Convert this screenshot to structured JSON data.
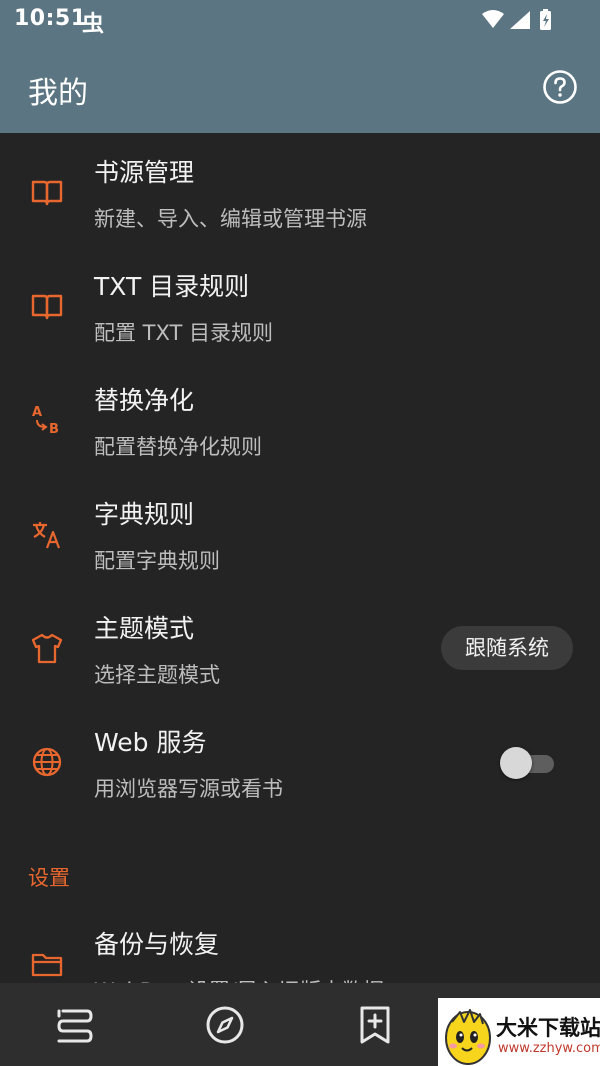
{
  "status_bar": {
    "time": "10:51",
    "notification_icon": "bug-icon",
    "icons": [
      "wifi-icon",
      "signal-icon",
      "battery-charging-icon"
    ]
  },
  "app_bar": {
    "title": "我的",
    "help_icon": "help-circle-icon"
  },
  "items": [
    {
      "icon": "book-open-icon",
      "title": "书源管理",
      "subtitle": "新建、导入、编辑或管理书源"
    },
    {
      "icon": "book-open-icon",
      "title": "TXT 目录规则",
      "subtitle": "配置 TXT 目录规则"
    },
    {
      "icon": "replace-ab-icon",
      "title": "替换净化",
      "subtitle": "配置替换净化规则"
    },
    {
      "icon": "translate-icon",
      "title": "字典规则",
      "subtitle": "配置字典规则"
    },
    {
      "icon": "tshirt-icon",
      "title": "主题模式",
      "subtitle": "选择主题模式",
      "value": "跟随系统"
    },
    {
      "icon": "globe-icon",
      "title": "Web 服务",
      "subtitle": "用浏览器写源或看书",
      "switch_on": false
    }
  ],
  "section": {
    "title": "设置"
  },
  "settings_items": [
    {
      "icon": "folder-icon",
      "title": "备份与恢复",
      "subtitle": "WebDav 设置/导入旧版本数据"
    }
  ],
  "bottom_nav": [
    "bookshelf-icon",
    "compass-icon",
    "bookmark-add-icon"
  ],
  "watermark": {
    "title": "大米下载站",
    "url": "www.zzhyw.com"
  },
  "colors": {
    "accent": "#e8672f",
    "app_bar": "#5b7682",
    "background": "#242424",
    "nav": "#2e2e2e"
  }
}
